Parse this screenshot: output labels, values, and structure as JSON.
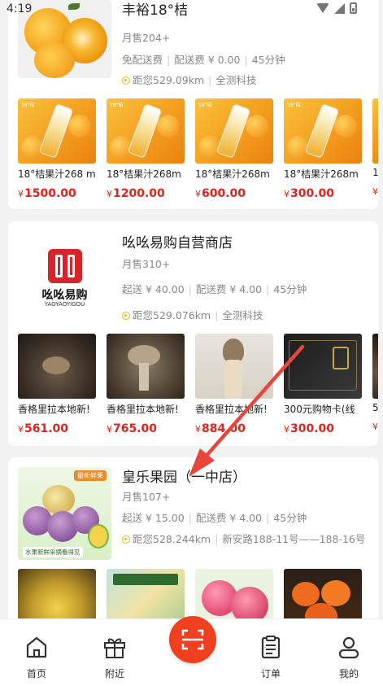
{
  "status_bar": {
    "time": "4:19"
  },
  "shops": [
    {
      "name": "丰裕18°桔",
      "monthly_sales": "月售204+",
      "delivery_min": "免配送费",
      "delivery_fee": "配送费 ¥ 0.00",
      "delivery_time": "45分钟",
      "distance": "距您529.09km",
      "location": "全测科技",
      "products": [
        {
          "name": "18°桔果汁268 m",
          "price": "1500.00"
        },
        {
          "name": "18°桔果汁268m",
          "price": "1200.00"
        },
        {
          "name": "18°桔果汁268m",
          "price": "600.00"
        },
        {
          "name": "18°桔果汁268m",
          "price": "300.00"
        },
        {
          "name": "1",
          "price": ""
        }
      ]
    },
    {
      "name": "吆吆易购自营商店",
      "logo_text": "吆吆易购",
      "logo_sub": "YAOYAOYIGOU",
      "monthly_sales": "月售310+",
      "delivery_min": "起送 ¥ 40.00",
      "delivery_fee": "配送费 ¥ 4.00",
      "delivery_time": "45分钟",
      "distance": "距您529.076km",
      "location": "全测科技",
      "products": [
        {
          "name": "香格里拉本地新!",
          "price": "561.00"
        },
        {
          "name": "香格里拉本地新!",
          "price": "765.00"
        },
        {
          "name": "香格里拉本地新!",
          "price": "884.00"
        },
        {
          "name": "300元购物卡(线",
          "price": "300.00"
        },
        {
          "name": "5",
          "price": ""
        }
      ]
    },
    {
      "name": "皇乐果园（一中店）",
      "thumb_tag": "最新鲜果",
      "thumb_caption": "水果新鲜采摘看得见",
      "monthly_sales": "月售107+",
      "delivery_min": "起送 ¥ 15.00",
      "delivery_fee": "配送费 ¥ 4.00",
      "delivery_time": "45分钟",
      "distance": "距您528.244km",
      "location": "新安路188-11号——188-16号"
    }
  ],
  "tab_bar": {
    "tabs": [
      {
        "label": "首页",
        "icon": "home-icon"
      },
      {
        "label": "附近",
        "icon": "gift-icon"
      },
      {
        "label": "",
        "icon": "scan-icon"
      },
      {
        "label": "订单",
        "icon": "clipboard-icon"
      },
      {
        "label": "我的",
        "icon": "user-icon"
      }
    ]
  },
  "colors": {
    "accent": "#f0401f",
    "price": "#e2231a",
    "annotation": "#e8453c"
  }
}
